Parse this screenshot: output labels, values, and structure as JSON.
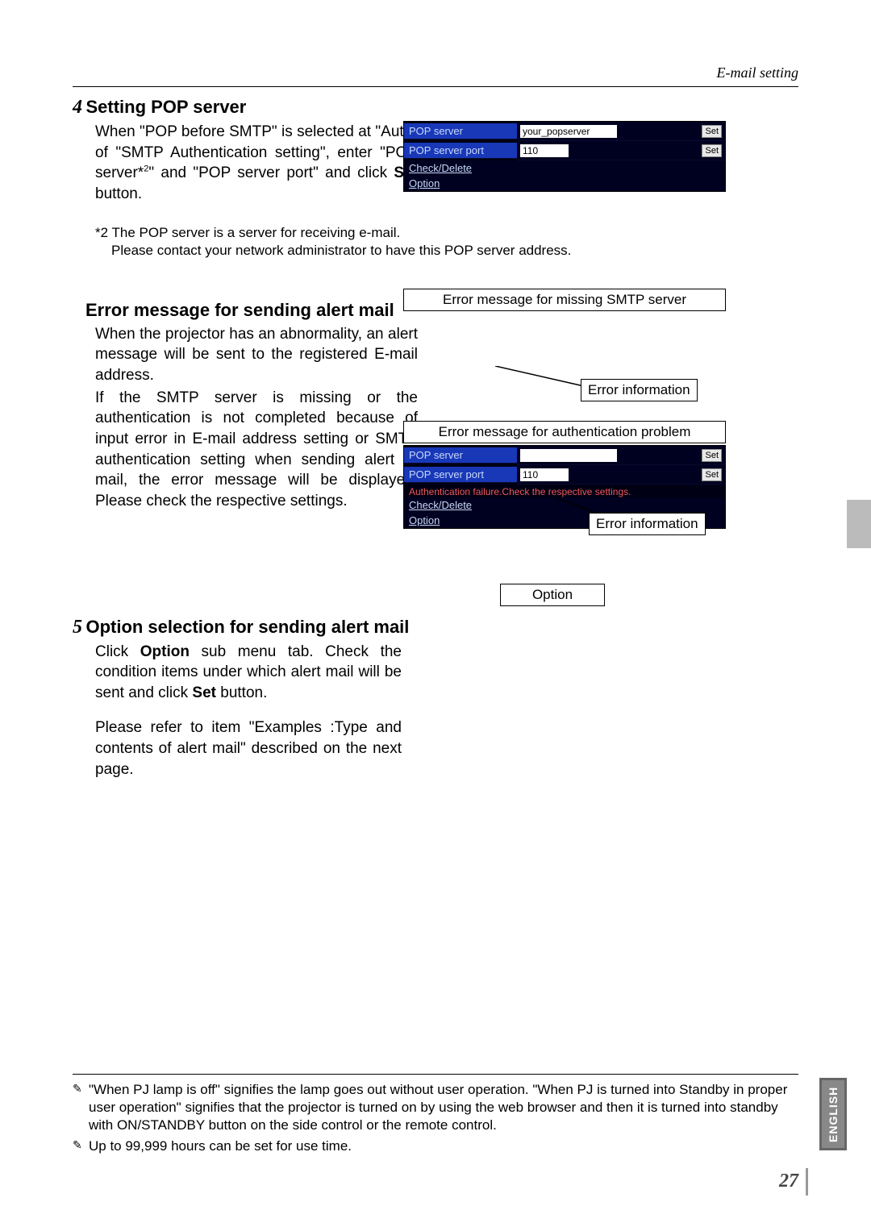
{
  "header": {
    "title": "E-mail setting"
  },
  "step4": {
    "num": "4",
    "title": "Setting POP server",
    "body_pre": "When \"POP before SMTP\" is selected at \"Auth\" of \"SMTP Authentication setting\", enter \"POP server*",
    "body_sup": "2",
    "body_post": "\" and \"POP server port\" and click ",
    "body_bold": "Set",
    "body_end": " button.",
    "footnote_head": "*2 The POP server is a server for receiving e-mail.",
    "footnote_body": "Please contact your network administrator to have this POP server address."
  },
  "pop_panel": {
    "row1_label": "POP server",
    "row1_value": "your_popserver",
    "row2_label": "POP server port",
    "row2_value": "110",
    "set_label": "Set",
    "link1": "Check/Delete",
    "link2": "Option"
  },
  "error_section": {
    "title": "Error message for sending alert mail",
    "p1": "When the projector has an abnormality, an alert message will be sent to the registered E-mail address.",
    "p2": "If the SMTP server is missing or the authentication is not completed because of input error in E-mail address setting or SMTP authentication setting when sending alert e-mail, the error message will be displayed. Please check the respective settings.",
    "callout1": "Error message for missing SMTP server",
    "callout_err": "Error information",
    "callout2": "Error message for authentication problem",
    "callout_err2": "Error information"
  },
  "err_panel2": {
    "row1_label": "POP server",
    "row1_value": "",
    "row2_label": "POP server port",
    "row2_value": "110",
    "set_label": "Set",
    "err_text": "Authentication failure.Check the respective settings.",
    "link1": "Check/Delete",
    "link2": "Option"
  },
  "step5": {
    "num": "5",
    "title": "Option selection for sending alert mail",
    "p1_pre": "Click ",
    "p1_bold1": "Option",
    "p1_mid": " sub menu tab. Check the condition items under which alert mail will be sent and click ",
    "p1_bold2": "Set",
    "p1_end": " button.",
    "p2": "Please refer to item \"Examples :Type and contents of alert mail\" described on the next page.",
    "option_label": "Option"
  },
  "footer": {
    "note1": "\"When PJ lamp is off\" signifies the lamp goes out without user operation. \"When PJ is turned into Standby  in proper user operation\" signifies that the projector is turned on by using the web browser and then it is turned into standby with ON/STANDBY button on the side control or the remote control.",
    "note2": "Up to 99,999 hours can be set for use time.",
    "lang": "ENGLISH",
    "page": "27"
  }
}
